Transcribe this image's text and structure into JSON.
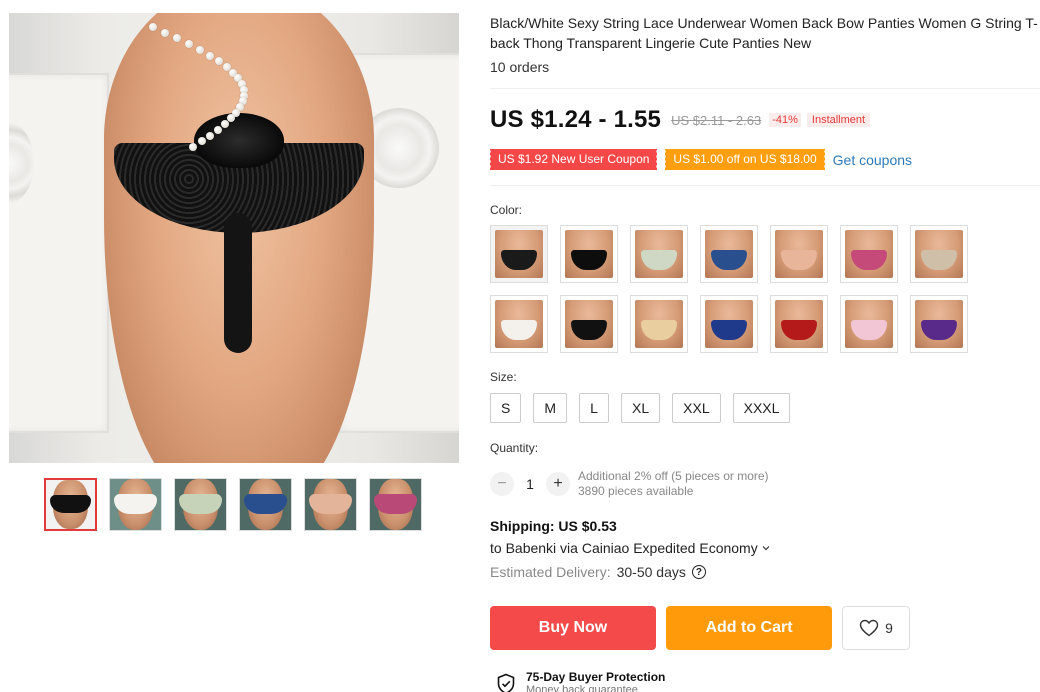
{
  "product": {
    "title": "Black/White Sexy String Lace Underwear Women Back Bow Panties Women G String T-back Thong Transparent Lingerie Cute Panties New",
    "orders": "10 orders"
  },
  "price": {
    "current": "US $1.24 - 1.55",
    "original": "US $2.11 - 2.63",
    "discount": "-41%",
    "installment": "Installment"
  },
  "coupons": {
    "new_user": "US $1.92 New User Coupon",
    "store": "US $1.00 off on US $18.00",
    "get_link": "Get coupons"
  },
  "color": {
    "label": "Color:",
    "swatches": [
      {
        "garment": "#1a1a1a",
        "bg": "#f3f3f3"
      },
      {
        "garment": "#0d0d0d",
        "bg": "#ffffff"
      },
      {
        "garment": "#cfd8c4",
        "bg": "#ffffff"
      },
      {
        "garment": "#2a4f8f",
        "bg": "#ffffff"
      },
      {
        "garment": "#e8b59b",
        "bg": "#ffffff"
      },
      {
        "garment": "#c54a7a",
        "bg": "#ffffff"
      },
      {
        "garment": "#cfbfa8",
        "bg": "#ffffff"
      },
      {
        "garment": "#f4f1ec",
        "bg": "#ffffff"
      },
      {
        "garment": "#111111",
        "bg": "#ffffff"
      },
      {
        "garment": "#e9cfa0",
        "bg": "#ffffff"
      },
      {
        "garment": "#1f3a8a",
        "bg": "#ffffff"
      },
      {
        "garment": "#b51a1a",
        "bg": "#ffffff"
      },
      {
        "garment": "#f3c6d6",
        "bg": "#ffffff"
      },
      {
        "garment": "#5a2a8a",
        "bg": "#ffffff"
      }
    ]
  },
  "size": {
    "label": "Size:",
    "options": [
      "S",
      "M",
      "L",
      "XL",
      "XXL",
      "XXXL"
    ]
  },
  "quantity": {
    "label": "Quantity:",
    "minus": "−",
    "value": "1",
    "plus": "+",
    "note": "Additional 2% off (5 pieces or more)",
    "available": "3890 pieces available"
  },
  "shipping": {
    "title": "Shipping: US $0.53",
    "to": "to Babenki via Cainiao Expedited Economy",
    "delivery_label": "Estimated Delivery:",
    "delivery_days": "30-50 days",
    "help": "?"
  },
  "actions": {
    "buy_now": "Buy Now",
    "add_to_cart": "Add to Cart",
    "wishlist_count": "9"
  },
  "protection": {
    "title": "75-Day Buyer Protection",
    "subtitle": "Money back guarantee"
  },
  "thumbnails": [
    {
      "garment": "#111111",
      "bg": "#f2f2f2"
    },
    {
      "garment": "#f5f3ef",
      "bg": "#6e8f88"
    },
    {
      "garment": "#c7d3b8",
      "bg": "#4f6a64"
    },
    {
      "garment": "#2a4f8f",
      "bg": "#4f6a64"
    },
    {
      "garment": "#e3b39a",
      "bg": "#4f6a64"
    },
    {
      "garment": "#b94a78",
      "bg": "#4f6a64"
    }
  ]
}
